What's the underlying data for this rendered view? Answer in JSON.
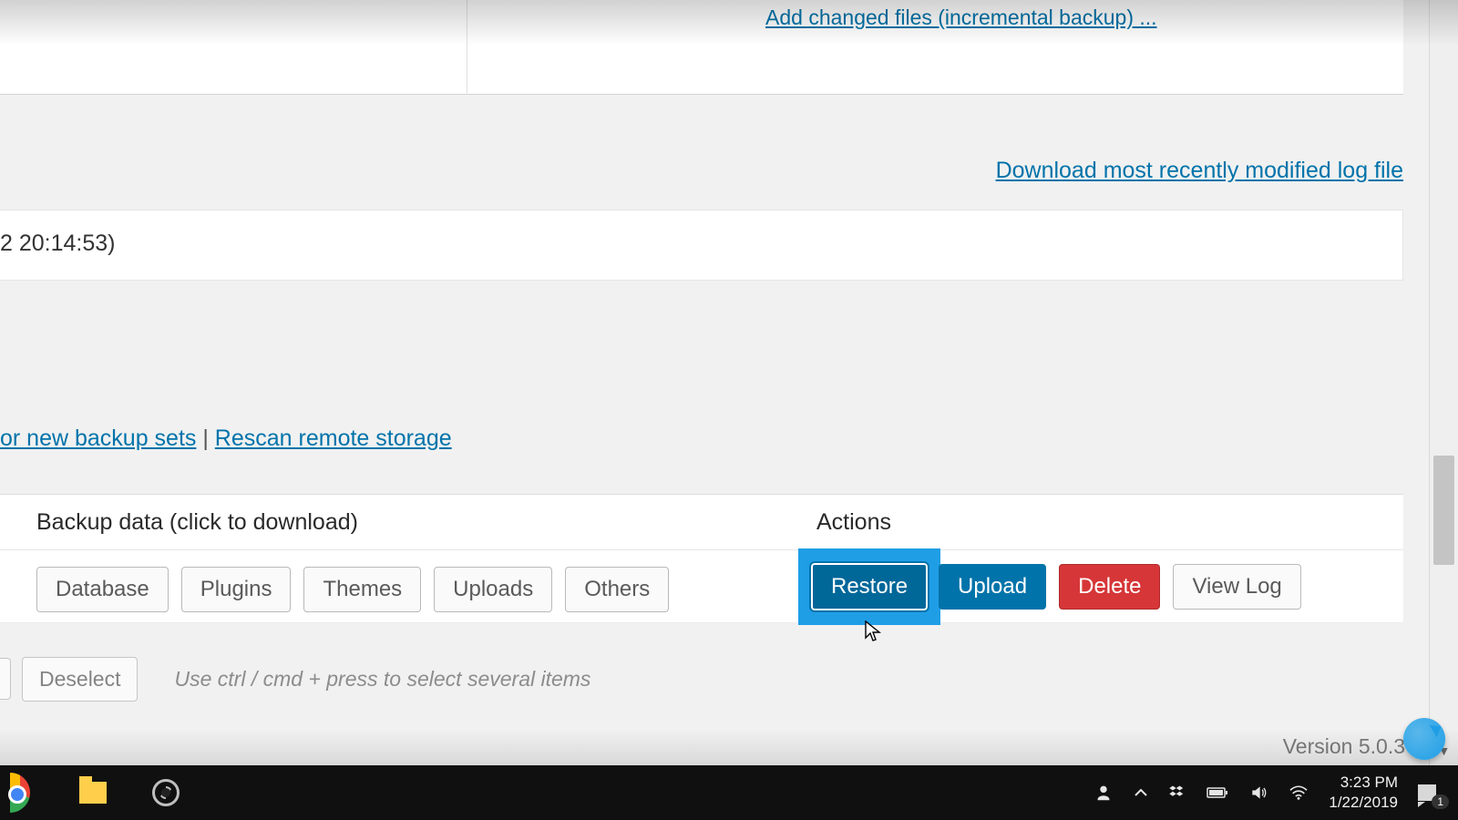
{
  "links": {
    "incremental": "Add changed files (incremental backup) ...",
    "download_log": "Download most recently modified log file",
    "rescan_new": "or new backup sets",
    "rescan_remote": "Rescan remote storage"
  },
  "timestamp_fragment": "2 20:14:53)",
  "separator": " | ",
  "table": {
    "header_data": "Backup data (click to download)",
    "header_actions": "Actions",
    "data_buttons": [
      "Database",
      "Plugins",
      "Themes",
      "Uploads",
      "Others"
    ],
    "actions": {
      "restore": "Restore",
      "upload": "Upload",
      "delete": "Delete",
      "viewlog": "View Log"
    }
  },
  "footer": {
    "deselect": "Deselect",
    "hint": "Use ctrl / cmd + press to select several items"
  },
  "version": "Version 5.0.3",
  "taskbar": {
    "time": "3:23 PM",
    "date": "1/22/2019",
    "notif_count": "1"
  }
}
